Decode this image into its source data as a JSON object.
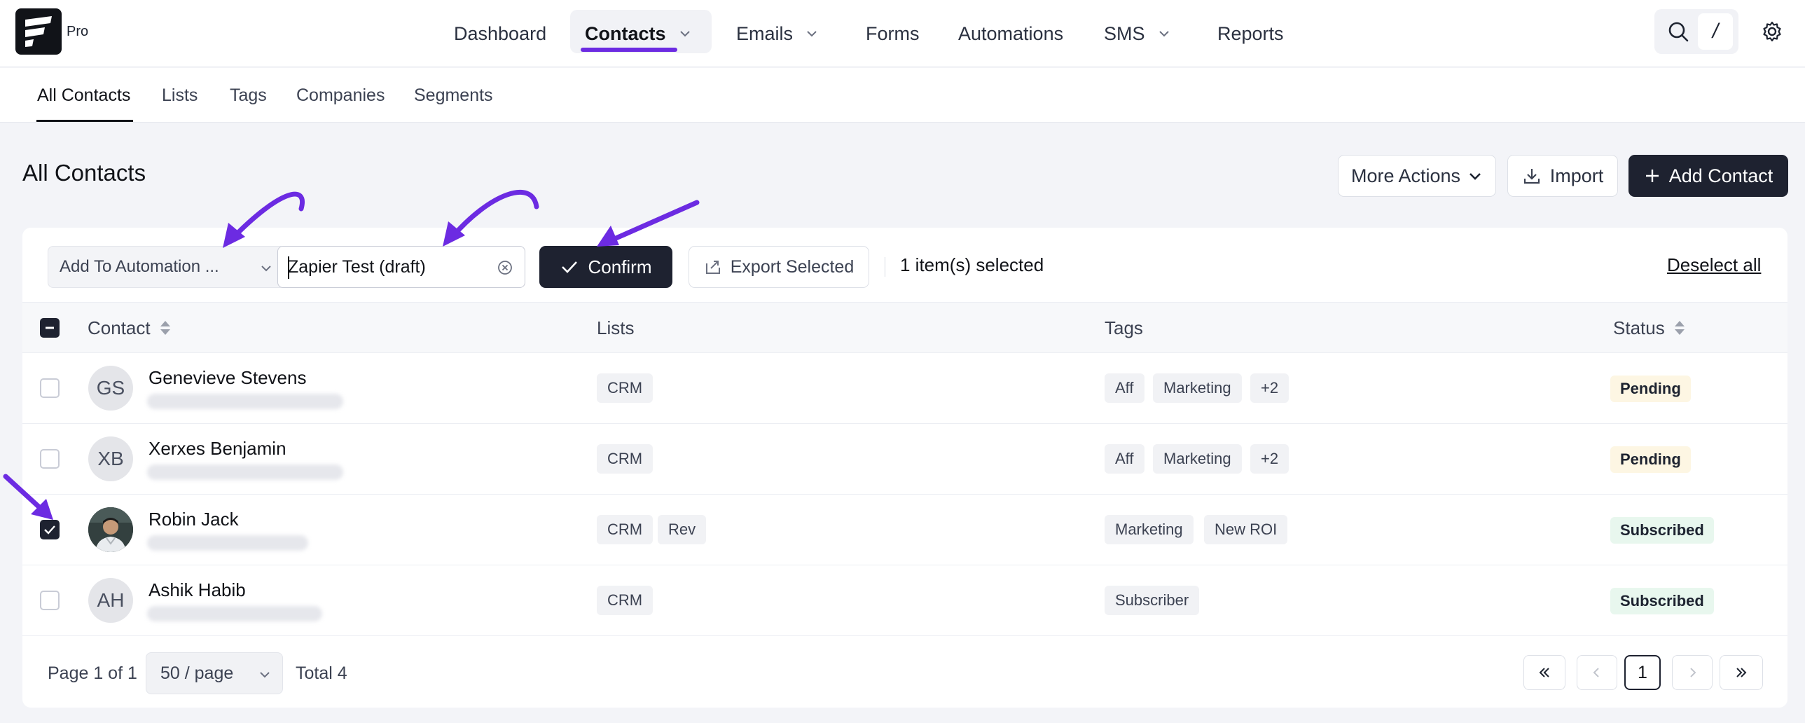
{
  "app": {
    "badge": "Pro"
  },
  "nav": {
    "items": [
      {
        "label": "Dashboard"
      },
      {
        "label": "Contacts"
      },
      {
        "label": "Emails"
      },
      {
        "label": "Forms"
      },
      {
        "label": "Automations"
      },
      {
        "label": "SMS"
      },
      {
        "label": "Reports"
      }
    ],
    "active": "Contacts",
    "search_shortcut": "/"
  },
  "subnav": {
    "items": [
      {
        "label": "All Contacts"
      },
      {
        "label": "Lists"
      },
      {
        "label": "Tags"
      },
      {
        "label": "Companies"
      },
      {
        "label": "Segments"
      }
    ],
    "active": "All Contacts"
  },
  "page": {
    "title": "All Contacts",
    "more_actions_label": "More Actions",
    "import_label": "Import",
    "add_contact_label": "Add Contact"
  },
  "bulk": {
    "action_value": "Add To Automation ...",
    "automation_value": "Zapier Test (draft)",
    "confirm_label": "Confirm",
    "export_label": "Export Selected",
    "selected_text": "1 item(s) selected",
    "deselect_label": "Deselect all"
  },
  "table": {
    "columns": {
      "contact": "Contact",
      "lists": "Lists",
      "tags": "Tags",
      "status": "Status"
    },
    "rows": [
      {
        "initials": "GS",
        "name": "Genevieve Stevens",
        "lists": [
          "CRM"
        ],
        "tags": [
          "Aff",
          "Marketing",
          "+2"
        ],
        "status": "Pending",
        "checked": false
      },
      {
        "initials": "XB",
        "name": "Xerxes Benjamin",
        "lists": [
          "CRM"
        ],
        "tags": [
          "Aff",
          "Marketing",
          "+2"
        ],
        "status": "Pending",
        "checked": false
      },
      {
        "initials": "",
        "name": "Robin Jack",
        "lists": [
          "CRM",
          "Rev"
        ],
        "tags": [
          "Marketing",
          "New ROI"
        ],
        "status": "Subscribed",
        "checked": true
      },
      {
        "initials": "AH",
        "name": "Ashik Habib",
        "lists": [
          "CRM"
        ],
        "tags": [
          "Subscriber"
        ],
        "status": "Subscribed",
        "checked": false
      }
    ]
  },
  "pagination": {
    "page_info": "Page 1 of 1",
    "per_page": "50 / page",
    "total": "Total 4",
    "current_page": "1"
  },
  "colors": {
    "accent": "#6c2be2",
    "dark": "#1e2230",
    "pending_bg": "#fdf6e3",
    "subscribed_bg": "#e8f7ee"
  }
}
